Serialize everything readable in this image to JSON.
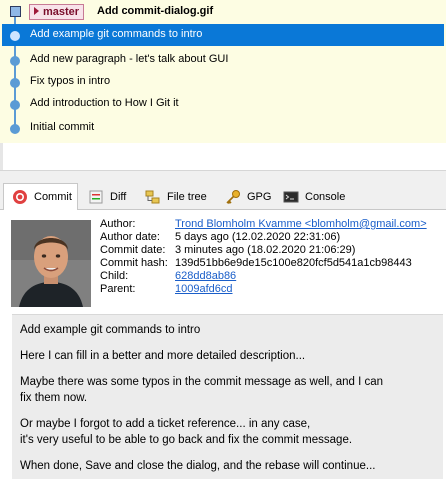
{
  "graph": {
    "branch_label": "master",
    "head_title": "Add commit-dialog.gif",
    "commits": [
      {
        "message": "Add example git commands to intro"
      },
      {
        "message": "Add new paragraph - let's talk about GUI"
      },
      {
        "message": "Fix typos in intro"
      },
      {
        "message": "Add introduction to How I Git it"
      },
      {
        "message": "Initial commit"
      }
    ]
  },
  "tabs": [
    {
      "label": "Commit",
      "icon": "commit-icon"
    },
    {
      "label": "Diff",
      "icon": "diff-icon"
    },
    {
      "label": "File tree",
      "icon": "file-tree-icon"
    },
    {
      "label": "GPG",
      "icon": "key-icon"
    },
    {
      "label": "Console",
      "icon": "console-icon"
    }
  ],
  "commit_info": {
    "author_label": "Author:",
    "author": "Trond Blomholm Kvamme <blomholm@gmail.com>",
    "author_date_label": "Author date:",
    "author_date": "5 days ago (12.02.2020 22:31:06)",
    "commit_date_label": "Commit date:",
    "commit_date": "3 minutes ago (18.02.2020 21:06:29)",
    "commit_hash_label": "Commit hash:",
    "commit_hash": "139d51bb6e9de15c100e820fcf5d541a1cb98443",
    "child_label": "Child:",
    "child": "628dd8ab86",
    "parent_label": "Parent:",
    "parent": "1009afd6cd"
  },
  "message_lines": [
    "Add example git commands to intro",
    "Here I can fill in a better and more detailed description...",
    "Maybe there was some typos in the commit message as well, and I can",
    "fix them now.",
    "Or maybe I forgot to add a ticket reference... in any case,",
    "it's very useful to be able to go back and fix the commit message.",
    "When done, Save and close the dialog, and the rebase will continue..."
  ],
  "colors": {
    "graph_background": "#fdfde3",
    "selection": "#0a78d7",
    "graph_line": "#5b9bd5",
    "branch_text": "#7a0d2b",
    "link": "#1a5ec9",
    "message_background": "#ececec"
  }
}
